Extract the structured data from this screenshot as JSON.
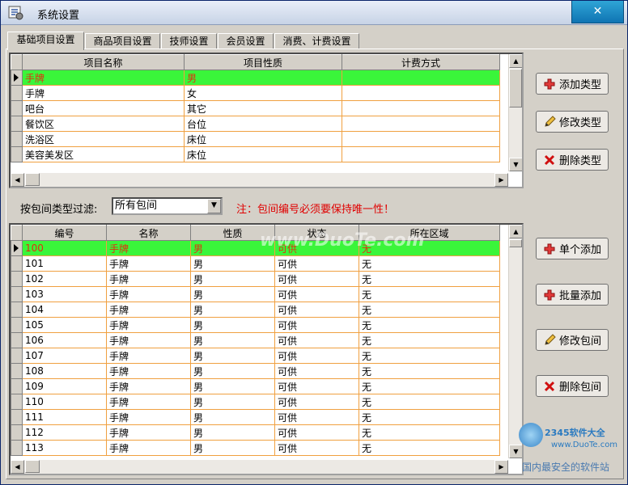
{
  "window": {
    "title": "系统设置",
    "close_symbol": "✕"
  },
  "tabs": [
    {
      "label": "基础项目设置",
      "active": true
    },
    {
      "label": "商品项目设置",
      "active": false
    },
    {
      "label": "技师设置",
      "active": false
    },
    {
      "label": "会员设置",
      "active": false
    },
    {
      "label": "消费、计费设置",
      "active": false
    }
  ],
  "type_grid": {
    "columns": [
      "项目名称",
      "项目性质",
      "计费方式"
    ],
    "rows": [
      [
        "手牌",
        "男",
        ""
      ],
      [
        "手牌",
        "女",
        ""
      ],
      [
        "吧台",
        "其它",
        ""
      ],
      [
        "餐饮区",
        "台位",
        ""
      ],
      [
        "洗浴区",
        "床位",
        ""
      ],
      [
        "美容美发区",
        "床位",
        ""
      ]
    ],
    "selected_row": 0
  },
  "type_buttons": {
    "add": "添加类型",
    "edit": "修改类型",
    "delete": "删除类型"
  },
  "filter": {
    "label": "按包间类型过滤:",
    "value": "所有包间"
  },
  "note": "注：包间编号必须要保持唯一性！",
  "room_grid": {
    "columns": [
      "编号",
      "名称",
      "性质",
      "状态",
      "所在区域"
    ],
    "rows": [
      [
        "100",
        "手牌",
        "男",
        "可供",
        "无"
      ],
      [
        "101",
        "手牌",
        "男",
        "可供",
        "无"
      ],
      [
        "102",
        "手牌",
        "男",
        "可供",
        "无"
      ],
      [
        "103",
        "手牌",
        "男",
        "可供",
        "无"
      ],
      [
        "104",
        "手牌",
        "男",
        "可供",
        "无"
      ],
      [
        "105",
        "手牌",
        "男",
        "可供",
        "无"
      ],
      [
        "106",
        "手牌",
        "男",
        "可供",
        "无"
      ],
      [
        "107",
        "手牌",
        "男",
        "可供",
        "无"
      ],
      [
        "108",
        "手牌",
        "男",
        "可供",
        "无"
      ],
      [
        "109",
        "手牌",
        "男",
        "可供",
        "无"
      ],
      [
        "110",
        "手牌",
        "男",
        "可供",
        "无"
      ],
      [
        "111",
        "手牌",
        "男",
        "可供",
        "无"
      ],
      [
        "112",
        "手牌",
        "男",
        "可供",
        "无"
      ],
      [
        "113",
        "手牌",
        "男",
        "可供",
        "无"
      ]
    ],
    "selected_row": 0
  },
  "room_buttons": {
    "single_add": "单个添加",
    "batch_add": "批量添加",
    "edit": "修改包间",
    "delete": "删除包间"
  },
  "watermarks": {
    "center": "www.DuoTe.com",
    "corner_top": "2345软件大全",
    "corner_url": "www.DuoTe.com",
    "corner_bottom": "国内最安全的软件站"
  },
  "icons": {
    "app": "settings-app-icon",
    "add": "plus-icon",
    "edit": "pencil-icon",
    "delete": "x-delete-icon"
  },
  "colors": {
    "selected_row": "#3af53a",
    "selected_text": "#e03010",
    "grid_line": "#f0a040",
    "note": "#e00000"
  }
}
